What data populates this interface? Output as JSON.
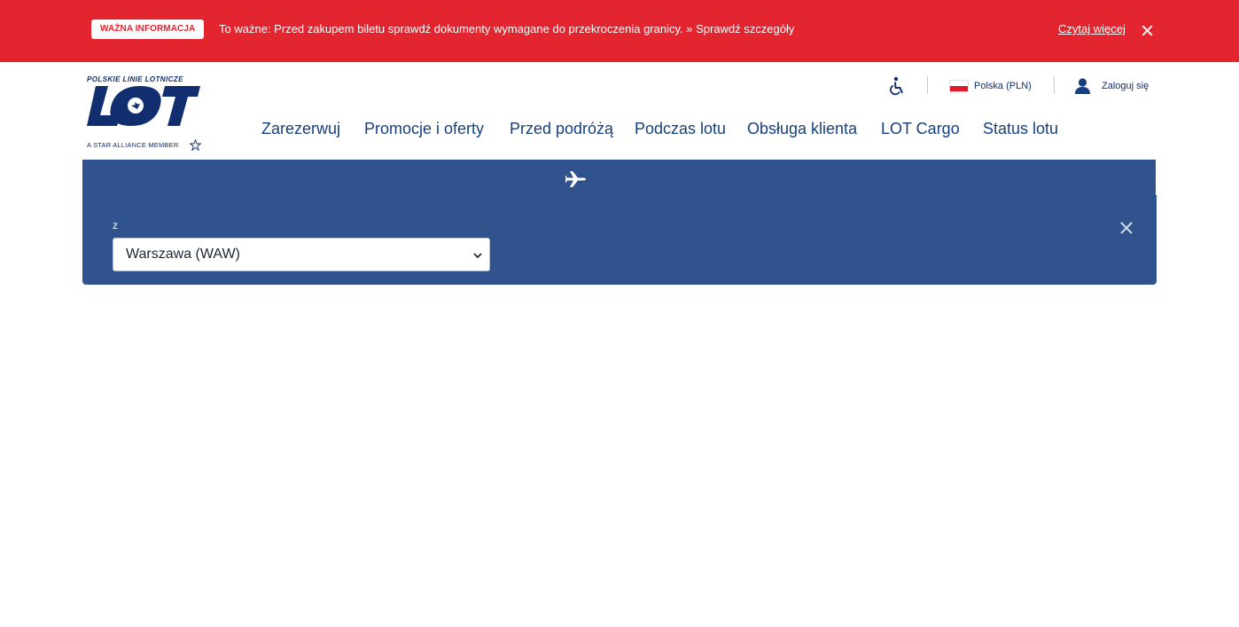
{
  "alert": {
    "badge": "WAŻNA INFORMACJA",
    "message": "To ważne: Przed zakupem biletu sprawdź dokumenty wymagane do przekroczenia granicy. » Sprawdź szczegóły",
    "read_more": "Czytaj więcej",
    "close_icon": "close-icon",
    "color": "#e32530"
  },
  "logo": {
    "tagline_top": "POLSKIE LINIE LOTNICZE",
    "wordmark": "LOT",
    "tagline_bottom": "A STAR ALLIANCE MEMBER",
    "color": "#112e6e"
  },
  "utility": {
    "accessibility_icon": "accessibility-icon",
    "language": "Polska (PLN)",
    "flag_icon": "poland-flag-icon",
    "login_icon": "user-icon",
    "login": "Zaloguj się"
  },
  "nav": {
    "items": [
      {
        "label": "Zarezerwuj"
      },
      {
        "label": "Promocje i oferty"
      },
      {
        "label": "Przed podróżą"
      },
      {
        "label": "Podczas lotu"
      },
      {
        "label": "Obsługa klienta"
      },
      {
        "label": "LOT Cargo"
      },
      {
        "label": "Status lotu"
      }
    ],
    "color": "#163f7f"
  },
  "booking": {
    "tab_icon": "airplane-icon",
    "from_label": "z",
    "from_value": "Warszawa (WAW)",
    "close_icon": "close-icon",
    "color": "#30538e"
  }
}
